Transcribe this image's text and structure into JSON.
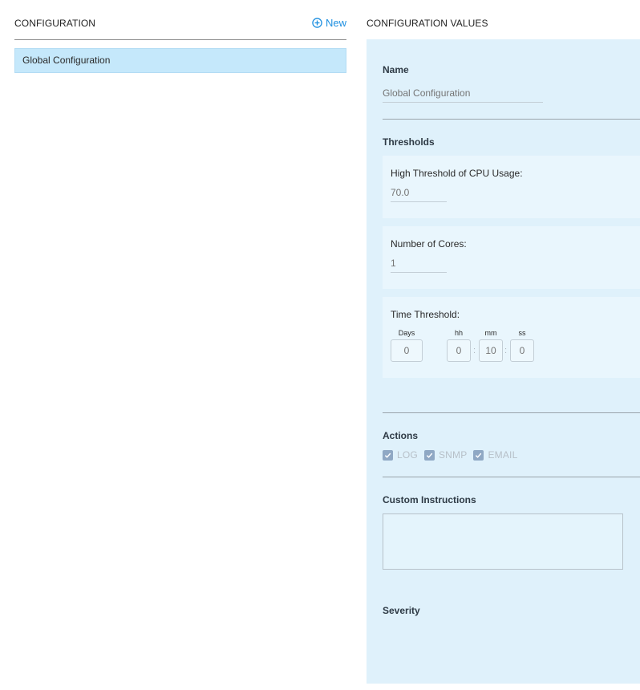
{
  "left": {
    "title": "CONFIGURATION",
    "new_label": "New",
    "items": [
      {
        "label": "Global Configuration",
        "selected": true
      }
    ]
  },
  "right": {
    "title": "CONFIGURATION VALUES",
    "name": {
      "label": "Name",
      "placeholder": "Global Configuration",
      "value": ""
    },
    "thresholds": {
      "label": "Thresholds",
      "cpu": {
        "label": "High Threshold of CPU Usage:",
        "placeholder": "70.0",
        "value": ""
      },
      "cores": {
        "label": "Number of Cores:",
        "placeholder": "1",
        "value": ""
      },
      "time": {
        "label": "Time Threshold:",
        "days_label": "Days",
        "hh_label": "hh",
        "mm_label": "mm",
        "ss_label": "ss",
        "days": "0",
        "hh": "0",
        "mm": "10",
        "ss": "0",
        "separator": ":"
      }
    },
    "actions": {
      "label": "Actions",
      "options": [
        {
          "label": "LOG",
          "checked": true
        },
        {
          "label": "SNMP",
          "checked": true
        },
        {
          "label": "EMAIL",
          "checked": true
        }
      ]
    },
    "custom_instructions": {
      "label": "Custom Instructions",
      "value": ""
    },
    "severity": {
      "label": "Severity"
    }
  },
  "colors": {
    "accent": "#1d8fe0",
    "selected_item_bg": "#c5e8fb",
    "panel_bg": "#dff1fb",
    "card_bg": "#e9f6fd",
    "checkbox": "#8fa8c4"
  },
  "icons": {
    "new": "plus-circle-icon",
    "check": "checkmark-icon"
  }
}
